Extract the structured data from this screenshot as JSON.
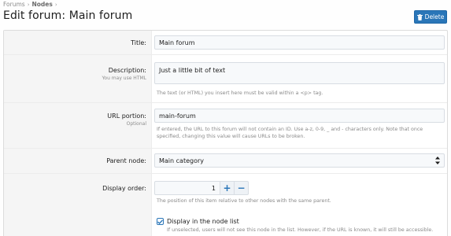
{
  "breadcrumb": {
    "items": [
      "Forums",
      "Nodes"
    ],
    "separator": "›"
  },
  "page_title": "Edit forum: Main forum",
  "delete_button": {
    "label": "Delete",
    "icon": "trash-icon",
    "color": "#2a76b8"
  },
  "form": {
    "title": {
      "label": "Title:",
      "value": "Main forum"
    },
    "description": {
      "label": "Description:",
      "sublabel": "You may use HTML",
      "value": "Just a little bit of text",
      "hint": "The text (or HTML) you insert here must be valid within a <p> tag."
    },
    "url_portion": {
      "label": "URL portion:",
      "sublabel": "Optional",
      "value": "main-forum",
      "hint": "If entered, the URL to this forum will not contain an ID. Use a-z, 0-9, _ and - characters only. Note that once specified, changing this value will cause URLs to be broken."
    },
    "parent_node": {
      "label": "Parent node:",
      "value": "Main category"
    },
    "display_order": {
      "label": "Display order:",
      "value": "1",
      "increment": "+",
      "decrement": "−",
      "hint": "The position of this item relative to other nodes with the same parent."
    },
    "display_in_list": {
      "checked": true,
      "label": "Display in the node list",
      "hint": "If unselected, users will not see this node in the list. However, if the URL is known, it will still be accessible."
    }
  }
}
